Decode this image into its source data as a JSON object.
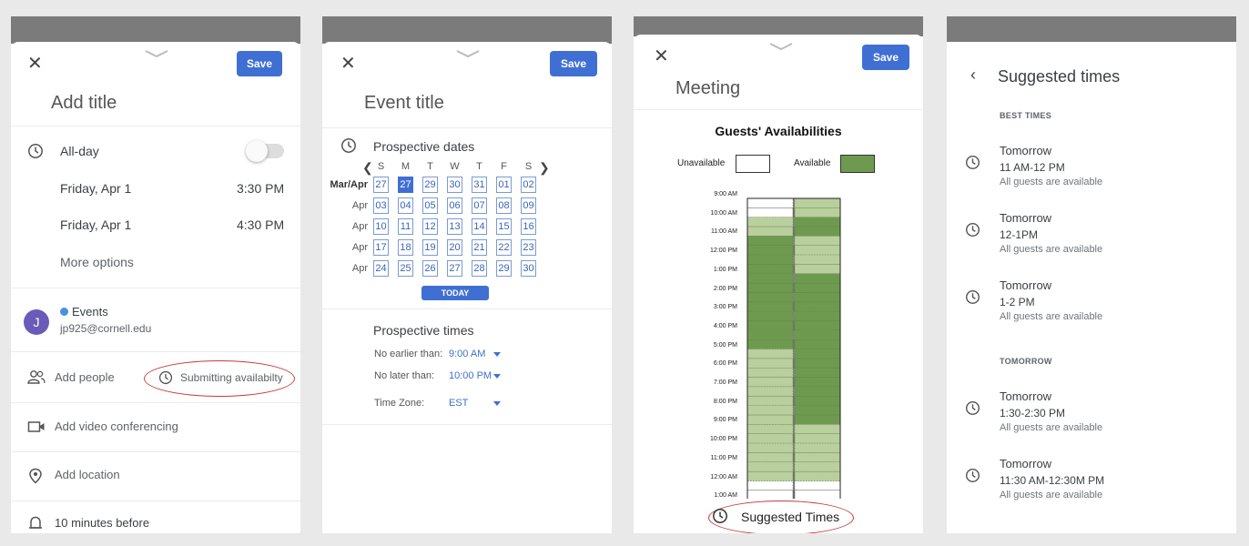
{
  "screen1": {
    "save_label": "Save",
    "title_placeholder": "Add title",
    "allday_label": "All-day",
    "start_date": "Friday, Apr 1",
    "start_time": "3:30 PM",
    "end_date": "Friday, Apr 1",
    "end_time": "4:30 PM",
    "more_options": "More options",
    "calendar_name": "Events",
    "calendar_email": "jp925@cornell.edu",
    "avatar_letter": "J",
    "add_people": "Add people",
    "submitting_availability": "Submitting availabilty",
    "add_video": "Add video conferencing",
    "add_location": "Add location",
    "reminder": "10 minutes before"
  },
  "screen2": {
    "save_label": "Save",
    "title_placeholder": "Event title",
    "prospective_dates": "Prospective dates",
    "weekdays": [
      "S",
      "M",
      "T",
      "W",
      "T",
      "F",
      "S"
    ],
    "rows": [
      {
        "label": "Mar/Apr",
        "days": [
          "27",
          "27",
          "29",
          "30",
          "31",
          "01",
          "02"
        ]
      },
      {
        "label": "Apr",
        "days": [
          "03",
          "04",
          "05",
          "06",
          "07",
          "08",
          "09"
        ]
      },
      {
        "label": "Apr",
        "days": [
          "10",
          "11",
          "12",
          "13",
          "14",
          "15",
          "16"
        ]
      },
      {
        "label": "Apr",
        "days": [
          "17",
          "18",
          "19",
          "20",
          "21",
          "22",
          "23"
        ]
      },
      {
        "label": "Apr",
        "days": [
          "24",
          "25",
          "26",
          "27",
          "28",
          "29",
          "30"
        ]
      }
    ],
    "selected_day": "27",
    "today_label": "TODAY",
    "prospective_times": "Prospective times",
    "no_earlier_label": "No earlier than:",
    "no_earlier_value": "9:00 AM",
    "no_later_label": "No later than:",
    "no_later_value": "10:00 PM",
    "timezone_label": "Time Zone:",
    "timezone_value": "EST"
  },
  "screen3": {
    "save_label": "Save",
    "title": "Meeting",
    "chart_title": "Guests' Availabilities",
    "legend_unavailable": "Unavailable",
    "legend_available": "Available",
    "times": [
      "9:00 AM",
      "10:00 AM",
      "11:00 AM",
      "12:00 PM",
      "1:00 PM",
      "2:00 PM",
      "3:00 PM",
      "4:00 PM",
      "5:00 PM",
      "6:00 PM",
      "7:00 PM",
      "8:00 PM",
      "9:00 PM",
      "10:00 PM",
      "11:00 PM",
      "12:00 AM",
      "1:00 AM"
    ],
    "suggested_link": "Suggested Times",
    "colors": {
      "available": "#6e9a4f",
      "partial": "#b9cf9d",
      "unavailable": "#ffffff"
    }
  },
  "screen4": {
    "title": "Suggested times",
    "best_label": "BEST TIMES",
    "tomorrow_label": "TOMORROW",
    "best": [
      {
        "day": "Tomorrow",
        "time": "11 AM-12 PM",
        "note": "All guests are available"
      },
      {
        "day": "Tomorrow",
        "time": "12-1PM",
        "note": "All guests are available"
      },
      {
        "day": "Tomorrow",
        "time": "1-2 PM",
        "note": "All guests are available"
      }
    ],
    "tomorrow": [
      {
        "day": "Tomorrow",
        "time": "1:30-2:30 PM",
        "note": "All guests are available"
      },
      {
        "day": "Tomorrow",
        "time": "11:30 AM-12:30M PM",
        "note": "All guests are available"
      }
    ]
  }
}
